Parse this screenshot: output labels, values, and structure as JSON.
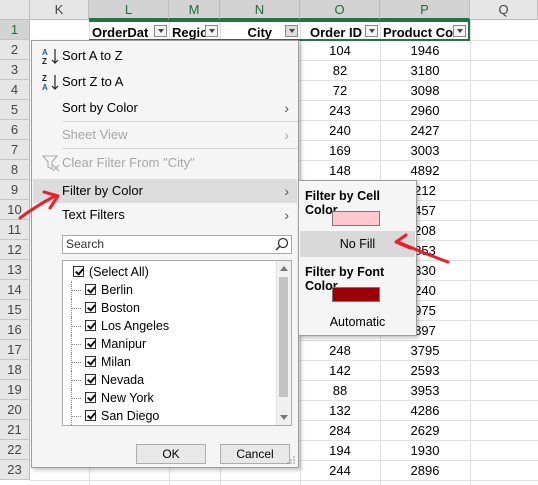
{
  "columns": [
    "K",
    "L",
    "M",
    "N",
    "O",
    "P",
    "Q"
  ],
  "rows": [
    "1",
    "2",
    "3",
    "4",
    "5",
    "6",
    "7",
    "8",
    "9",
    "10",
    "11",
    "12",
    "13",
    "14",
    "15",
    "16",
    "17",
    "18",
    "19",
    "20",
    "21",
    "22",
    "23"
  ],
  "headers": {
    "order_date": "OrderDat",
    "region": "Regio",
    "city": "City",
    "order_id": "Order ID",
    "product_code": "Product Co"
  },
  "order_ids": [
    "104",
    "82",
    "72",
    "243",
    "240",
    "169",
    "148",
    "",
    "",
    "",
    "",
    "",
    "",
    "",
    "",
    "248",
    "142",
    "88",
    "132",
    "284",
    "194",
    "244"
  ],
  "product_codes": [
    "1946",
    "3180",
    "3098",
    "2960",
    "2427",
    "3003",
    "4892",
    "212",
    "457",
    "208",
    "853",
    "330",
    "240",
    "975",
    "897",
    "3795",
    "2593",
    "3953",
    "4286",
    "2629",
    "1930",
    "2896"
  ],
  "menu": {
    "sort_az": "Sort A to Z",
    "sort_za": "Sort Z to A",
    "sort_by_color": "Sort by Color",
    "sheet_view": "Sheet View",
    "clear_filter": "Clear Filter From \"City\"",
    "filter_by_color": "Filter by Color",
    "text_filters": "Text Filters",
    "search_placeholder": "Search",
    "list": [
      "(Select All)",
      "Berlin",
      "Boston",
      "Los Angeles",
      "Manipur",
      "Milan",
      "Nevada",
      "New York",
      "San Diego"
    ],
    "ok": "OK",
    "cancel": "Cancel"
  },
  "submenu": {
    "cell_color_header": "Filter by Cell Color",
    "cell_swatch": "#ffc7ce",
    "no_fill": "No Fill",
    "font_color_header": "Filter by Font Color",
    "font_swatch": "#9c0006",
    "automatic": "Automatic"
  },
  "colors": {
    "accent_green": "#217346",
    "annotation_red": "#e8202a"
  }
}
